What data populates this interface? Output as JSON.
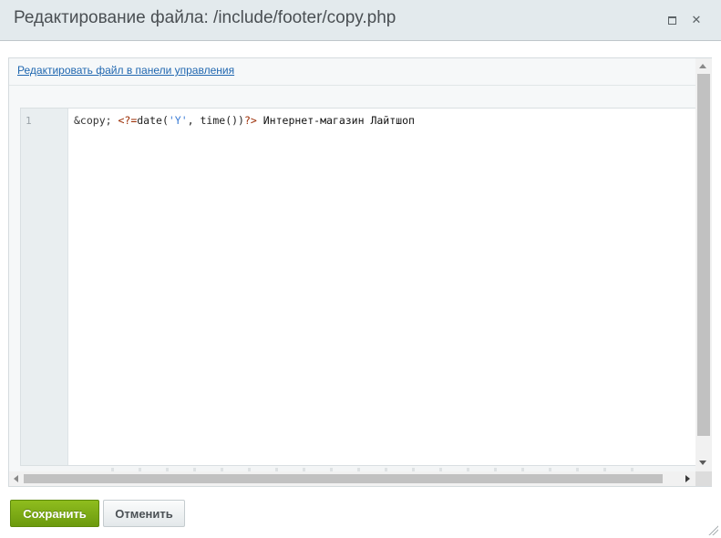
{
  "dialog": {
    "title": "Редактирование файла: /include/footer/copy.php",
    "maximize_icon": "maximize-icon",
    "close_icon": "close-icon",
    "close_glyph": "✕"
  },
  "content": {
    "edit_link": "Редактировать файл в панели управления"
  },
  "editor": {
    "line_number": "1",
    "code_tokens": {
      "entity": "&copy; ",
      "tag_open": "<?=",
      "fn": "date(",
      "str": "'Y'",
      "fn2": ", time())",
      "tag_close": "?>",
      "text": " Интернет-магазин Лайтшоп"
    }
  },
  "footer": {
    "save_label": "Сохранить",
    "cancel_label": "Отменить"
  },
  "colors": {
    "header_bg": "#e3eaed",
    "link": "#2067b0",
    "save_button": "#7aa816",
    "cancel_button": "#eef1f2"
  }
}
